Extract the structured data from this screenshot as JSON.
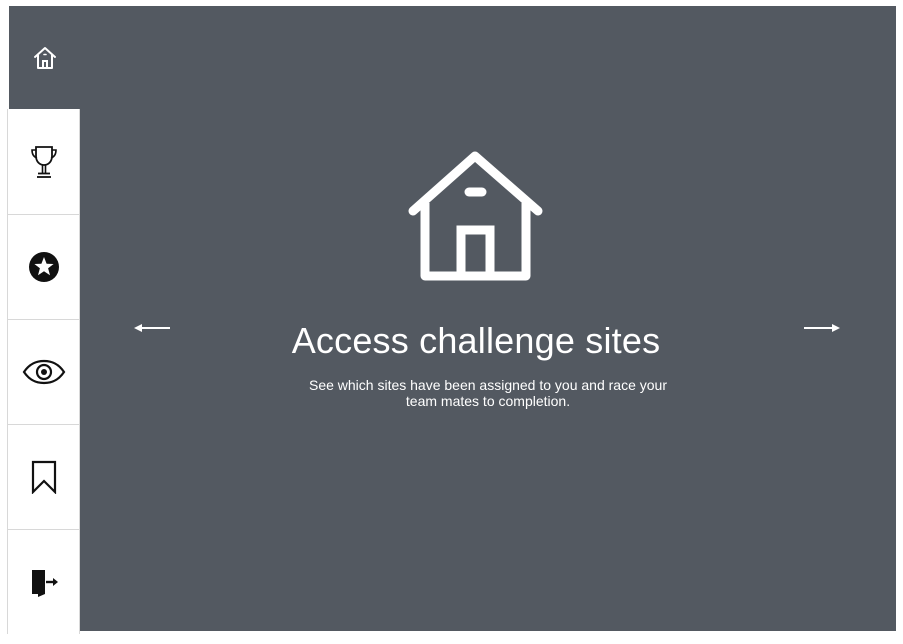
{
  "colors": {
    "panel_background": "#535961",
    "sidebar_background": "#ffffff",
    "icon_dark": "#111111",
    "icon_light": "#ffffff"
  },
  "nav": {
    "home_icon": "home-icon"
  },
  "sidebar": {
    "items": [
      {
        "icon": "trophy-icon"
      },
      {
        "icon": "star-badge-icon"
      },
      {
        "icon": "eye-icon"
      },
      {
        "icon": "bookmark-icon"
      },
      {
        "icon": "logout-icon"
      }
    ]
  },
  "slide": {
    "icon": "house-icon",
    "title": "Access challenge sites",
    "description": "See which sites have been assigned to you and race your team mates to completion.",
    "prev_icon": "arrow-left-icon",
    "next_icon": "arrow-right-icon"
  }
}
